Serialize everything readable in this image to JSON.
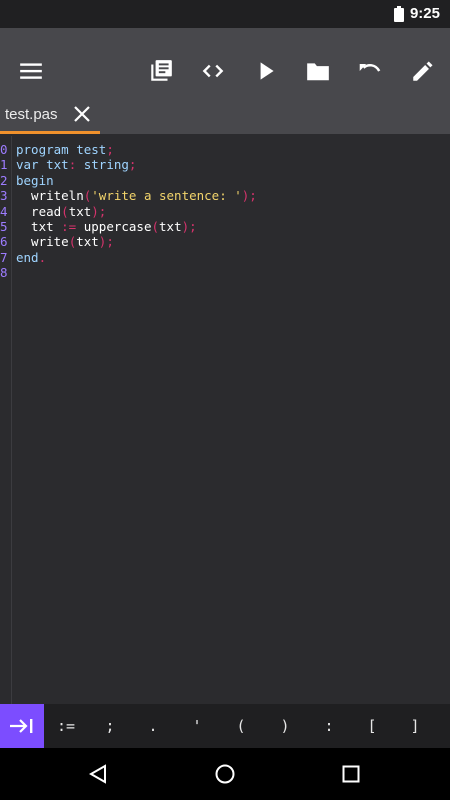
{
  "status_bar": {
    "time": "9:25",
    "battery_icon": "battery-full-icon"
  },
  "toolbar": {
    "icons": [
      "menu-icon",
      "library-icon",
      "code-icon",
      "run-icon",
      "folder-icon",
      "undo-icon",
      "edit-icon"
    ]
  },
  "tabs": [
    {
      "label": "test.pas",
      "close_icon": "close-icon",
      "active": true
    }
  ],
  "editor": {
    "line_numbers": [
      "0",
      "1",
      "2",
      "3",
      "4",
      "5",
      "6",
      "7",
      "8"
    ],
    "lines": [
      [
        {
          "t": "program test",
          "c": "#9fd4ff"
        },
        {
          "t": ";",
          "c": "#d6336c"
        }
      ],
      [
        {
          "t": "var txt",
          "c": "#9fd4ff"
        },
        {
          "t": ":",
          "c": "#d6336c"
        },
        {
          "t": " string",
          "c": "#9fd4ff"
        },
        {
          "t": ";",
          "c": "#d6336c"
        }
      ],
      [
        {
          "t": "begin",
          "c": "#9fd4ff"
        }
      ],
      [
        {
          "t": "  writeln",
          "c": "#ffffff"
        },
        {
          "t": "(",
          "c": "#d6336c"
        },
        {
          "t": "'write a sentence: '",
          "c": "#f2d46b"
        },
        {
          "t": ");",
          "c": "#d6336c"
        }
      ],
      [
        {
          "t": "  read",
          "c": "#ffffff"
        },
        {
          "t": "(",
          "c": "#d6336c"
        },
        {
          "t": "txt",
          "c": "#ffffff"
        },
        {
          "t": ");",
          "c": "#d6336c"
        }
      ],
      [
        {
          "t": "  txt ",
          "c": "#ffffff"
        },
        {
          "t": ":=",
          "c": "#d6336c"
        },
        {
          "t": " uppercase",
          "c": "#ffffff"
        },
        {
          "t": "(",
          "c": "#d6336c"
        },
        {
          "t": "txt",
          "c": "#ffffff"
        },
        {
          "t": ");",
          "c": "#d6336c"
        }
      ],
      [
        {
          "t": "  write",
          "c": "#ffffff"
        },
        {
          "t": "(",
          "c": "#d6336c"
        },
        {
          "t": "txt",
          "c": "#ffffff"
        },
        {
          "t": ");",
          "c": "#d6336c"
        }
      ],
      [
        {
          "t": "end",
          "c": "#9fd4ff"
        },
        {
          "t": ".",
          "c": "#d6336c"
        }
      ],
      []
    ]
  },
  "accessory_bar": {
    "tab_key_icon": "tab-key-icon",
    "keys": [
      ":=",
      ";",
      ".",
      "'",
      "(",
      ")",
      ":",
      "[",
      "]"
    ]
  },
  "nav_bar": {
    "icons": [
      "back-icon",
      "home-icon",
      "recents-icon"
    ]
  },
  "colors": {
    "accent": "#7c4dff",
    "tab_indicator": "#f0912c",
    "toolbar_bg": "#48484c",
    "editor_bg": "#2b2b2e",
    "line_number": "#9d7cff",
    "keyword": "#9fd4ff",
    "punctuation": "#d6336c",
    "string": "#f2d46b"
  }
}
